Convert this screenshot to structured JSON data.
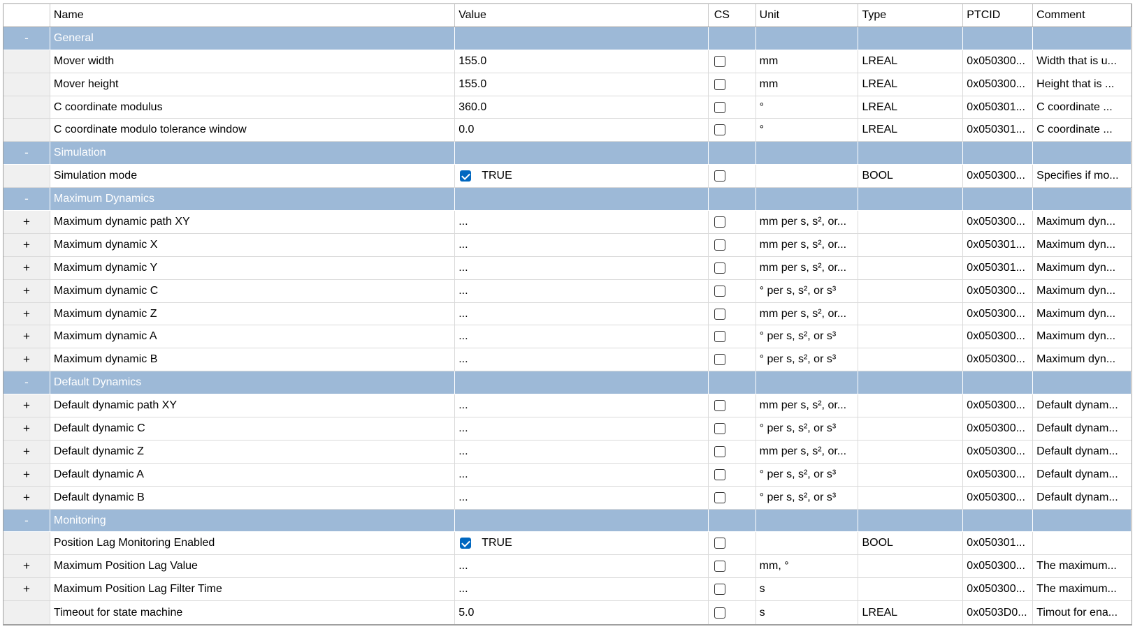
{
  "columns": [
    "",
    "Name",
    "Value",
    "CS",
    "Unit",
    "Type",
    "PTCID",
    "Comment"
  ],
  "rows": [
    {
      "kind": "group",
      "expander": "-",
      "name": "General"
    },
    {
      "kind": "item",
      "expander": "",
      "name": "Mover width",
      "value": "155.0",
      "unit": "mm",
      "type": "LREAL",
      "ptcid": "0x050300...",
      "comment": "Width that is u..."
    },
    {
      "kind": "item",
      "expander": "",
      "name": "Mover height",
      "value": "155.0",
      "unit": "mm",
      "type": "LREAL",
      "ptcid": "0x050300...",
      "comment": "Height that is ..."
    },
    {
      "kind": "item",
      "expander": "",
      "name": "C coordinate modulus",
      "value": "360.0",
      "unit": "°",
      "type": "LREAL",
      "ptcid": "0x050301...",
      "comment": "C coordinate ..."
    },
    {
      "kind": "item",
      "expander": "",
      "name": "C coordinate modulo tolerance window",
      "value": "0.0",
      "unit": "°",
      "type": "LREAL",
      "ptcid": "0x050301...",
      "comment": "C coordinate ..."
    },
    {
      "kind": "group",
      "expander": "-",
      "name": "Simulation"
    },
    {
      "kind": "item",
      "expander": "",
      "name": "Simulation mode",
      "value": "TRUE",
      "value_checkbox": true,
      "unit": "",
      "type": "BOOL",
      "ptcid": "0x050300...",
      "comment": "Specifies if mo..."
    },
    {
      "kind": "group",
      "expander": "-",
      "name": "Maximum Dynamics"
    },
    {
      "kind": "item",
      "expander": "+",
      "name": "Maximum dynamic path XY",
      "value": "...",
      "unit": "mm per s, s², or...",
      "type": "",
      "ptcid": "0x050300...",
      "comment": "Maximum dyn..."
    },
    {
      "kind": "item",
      "expander": "+",
      "name": "Maximum dynamic X",
      "value": "...",
      "unit": "mm per s, s², or...",
      "type": "",
      "ptcid": "0x050301...",
      "comment": "Maximum dyn..."
    },
    {
      "kind": "item",
      "expander": "+",
      "name": "Maximum dynamic Y",
      "value": "...",
      "unit": "mm per s, s², or...",
      "type": "",
      "ptcid": "0x050301...",
      "comment": "Maximum dyn..."
    },
    {
      "kind": "item",
      "expander": "+",
      "name": "Maximum dynamic C",
      "value": "...",
      "unit": "° per s, s², or s³",
      "type": "",
      "ptcid": "0x050300...",
      "comment": "Maximum dyn..."
    },
    {
      "kind": "item",
      "expander": "+",
      "name": "Maximum dynamic Z",
      "value": "...",
      "unit": "mm per s, s², or...",
      "type": "",
      "ptcid": "0x050300...",
      "comment": "Maximum dyn..."
    },
    {
      "kind": "item",
      "expander": "+",
      "name": "Maximum dynamic A",
      "value": "...",
      "unit": "° per s, s², or s³",
      "type": "",
      "ptcid": "0x050300...",
      "comment": "Maximum dyn..."
    },
    {
      "kind": "item",
      "expander": "+",
      "name": "Maximum dynamic B",
      "value": "...",
      "unit": "° per s, s², or s³",
      "type": "",
      "ptcid": "0x050300...",
      "comment": "Maximum dyn..."
    },
    {
      "kind": "group",
      "expander": "-",
      "name": "Default Dynamics"
    },
    {
      "kind": "item",
      "expander": "+",
      "name": "Default dynamic path XY",
      "value": "...",
      "unit": "mm per s, s², or...",
      "type": "",
      "ptcid": "0x050300...",
      "comment": "Default dynam..."
    },
    {
      "kind": "item",
      "expander": "+",
      "name": "Default dynamic C",
      "value": "...",
      "unit": "° per s, s², or s³",
      "type": "",
      "ptcid": "0x050300...",
      "comment": "Default dynam..."
    },
    {
      "kind": "item",
      "expander": "+",
      "name": "Default dynamic Z",
      "value": "...",
      "unit": "mm per s, s², or...",
      "type": "",
      "ptcid": "0x050300...",
      "comment": "Default dynam..."
    },
    {
      "kind": "item",
      "expander": "+",
      "name": "Default dynamic A",
      "value": "...",
      "unit": "° per s, s², or s³",
      "type": "",
      "ptcid": "0x050300...",
      "comment": "Default dynam..."
    },
    {
      "kind": "item",
      "expander": "+",
      "name": "Default dynamic B",
      "value": "...",
      "unit": "° per s, s², or s³",
      "type": "",
      "ptcid": "0x050300...",
      "comment": "Default dynam..."
    },
    {
      "kind": "group",
      "expander": "-",
      "name": "Monitoring"
    },
    {
      "kind": "item",
      "expander": "",
      "name": "Position Lag Monitoring Enabled",
      "value": "TRUE",
      "value_checkbox": true,
      "unit": "",
      "type": "BOOL",
      "ptcid": "0x050301...",
      "comment": ""
    },
    {
      "kind": "item",
      "expander": "+",
      "name": "Maximum Position Lag Value",
      "value": "...",
      "unit": "mm, °",
      "type": "",
      "ptcid": "0x050300...",
      "comment": "The maximum..."
    },
    {
      "kind": "item",
      "expander": "+",
      "name": "Maximum Position Lag Filter Time",
      "value": "...",
      "unit": "s",
      "type": "",
      "ptcid": "0x050300...",
      "comment": "The maximum..."
    },
    {
      "kind": "item",
      "expander": "",
      "name": "Timeout for state machine",
      "value": "5.0",
      "unit": "s",
      "type": "LREAL",
      "ptcid": "0x0503D0...",
      "comment": "Timout for ena..."
    }
  ]
}
